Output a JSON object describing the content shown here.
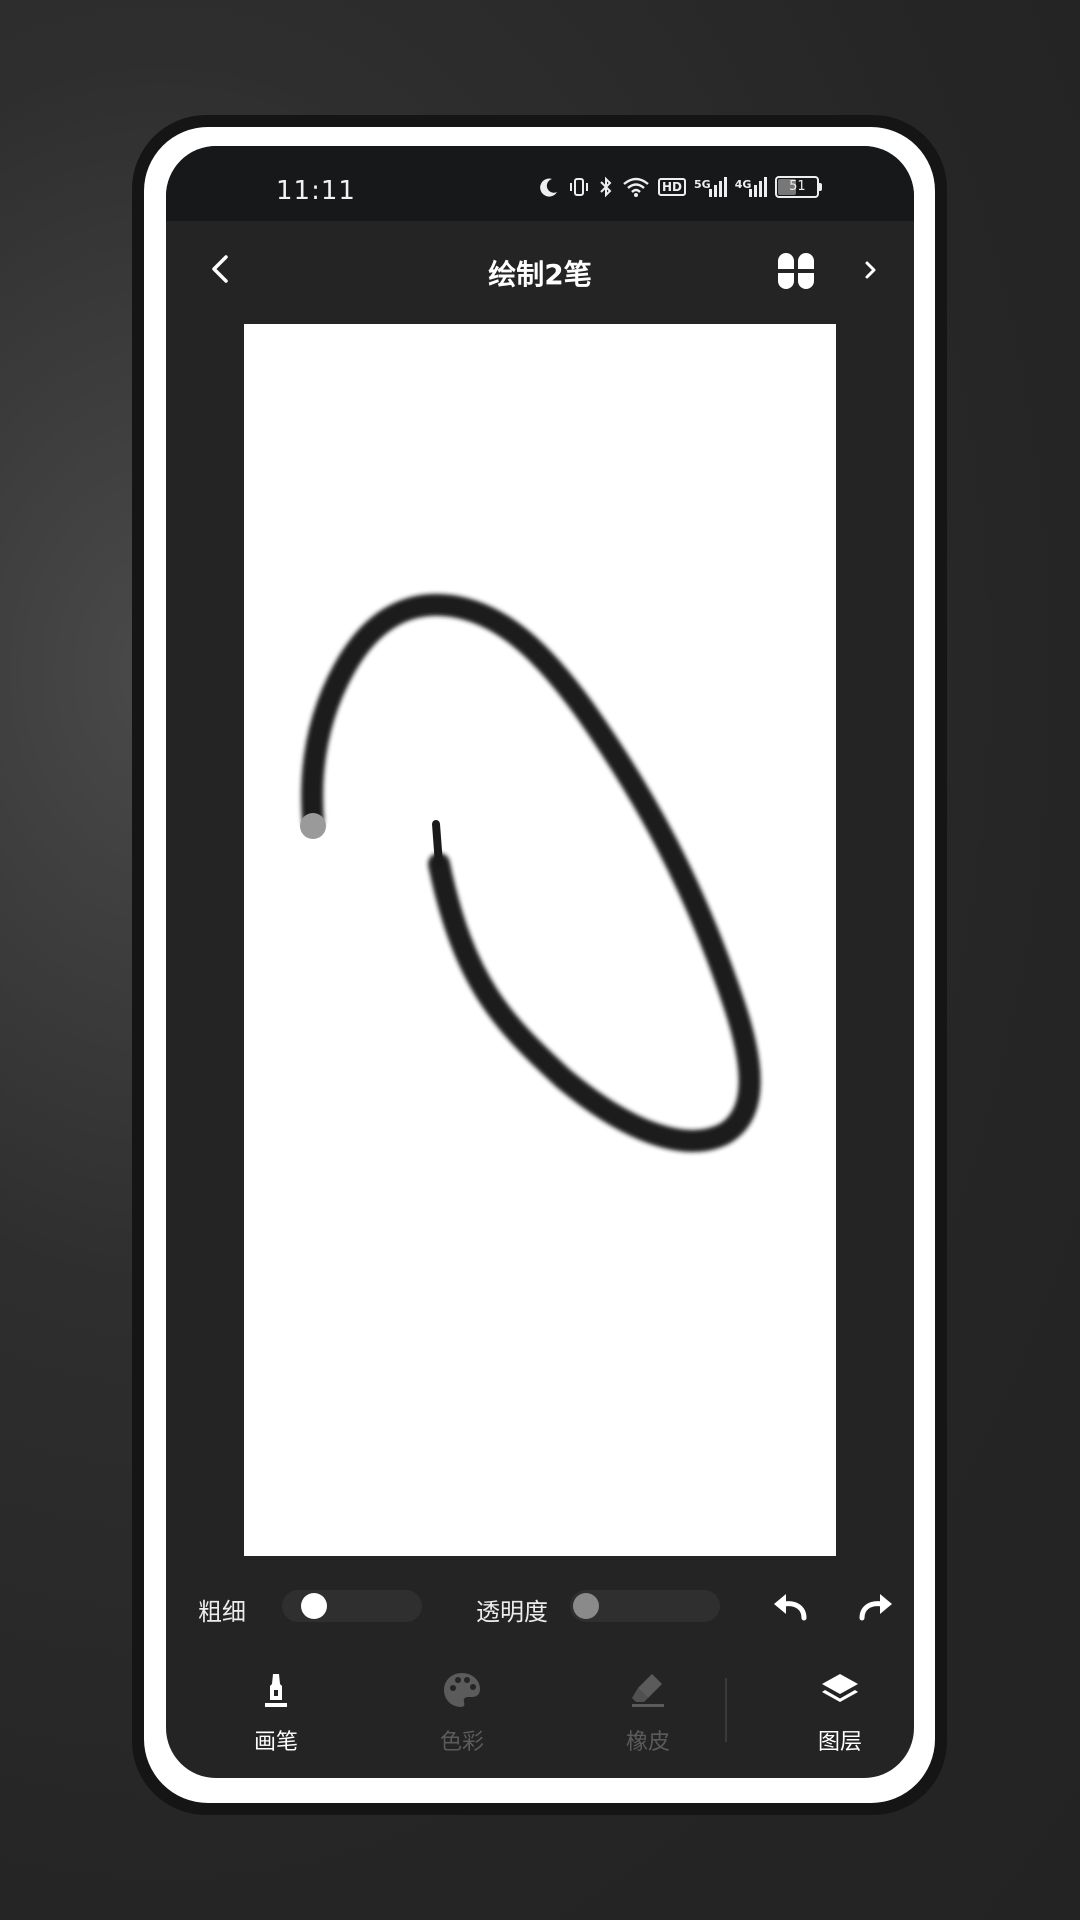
{
  "status_bar": {
    "time": "11:11",
    "network_5g": "5G",
    "network_4g": "4G",
    "hd": "HD",
    "battery": "51",
    "icons": [
      "moon-icon",
      "vibrate-icon",
      "bluetooth-icon",
      "wifi-icon",
      "hd-icon",
      "signal-5g-icon",
      "signal-4g-icon",
      "battery-icon"
    ]
  },
  "header": {
    "title": "绘制2笔",
    "back_icon": "chevron-left-icon",
    "menu_icon": "four-petal-grid-icon",
    "next_icon": "chevron-right-icon"
  },
  "canvas": {
    "background": "#ffffff",
    "stroke_color": "#1a1a1a",
    "stroke_count": 2
  },
  "controls": {
    "thickness_label": "粗细",
    "thickness_value": 0.15,
    "opacity_label": "透明度",
    "opacity_value": 0.0,
    "undo_icon": "undo-icon",
    "redo_icon": "redo-icon"
  },
  "tabs": [
    {
      "label": "画笔",
      "icon": "brush-icon",
      "active": true
    },
    {
      "label": "色彩",
      "icon": "palette-icon",
      "active": false
    },
    {
      "label": "橡皮",
      "icon": "eraser-icon",
      "active": false
    },
    {
      "label": "图层",
      "icon": "layers-icon",
      "active": true
    }
  ],
  "colors": {
    "active_tab": "#ffffff",
    "inactive_tab": "#5b5b5b",
    "screen_bg": "#242424",
    "status_bg": "#17181a"
  }
}
